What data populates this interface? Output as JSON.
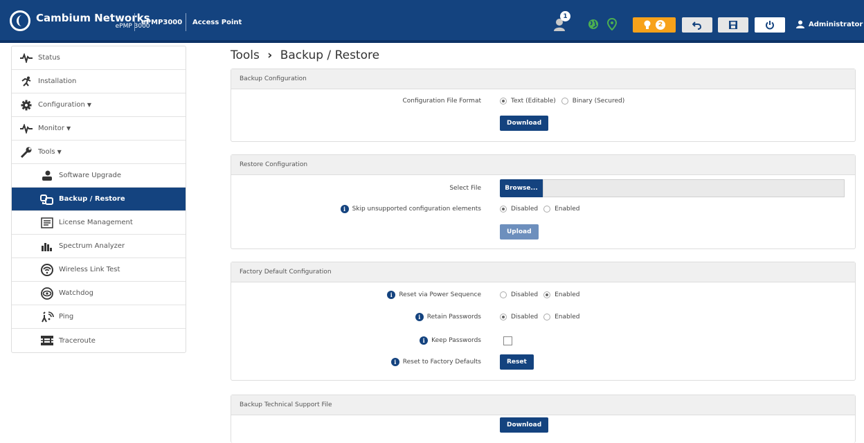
{
  "header": {
    "brand": "Cambium Networks",
    "model": "ePMP 3000",
    "device": "ePMP3000",
    "mode": "Access Point",
    "notification_count": "1",
    "alert_count": "2",
    "user": "Administrator",
    "colors": {
      "bar": "#14437f",
      "alert": "#f7a21b",
      "green": "#4caf50"
    },
    "icons": [
      "user-notification-icon",
      "globe-icon",
      "map-pin-icon",
      "lightbulb-icon",
      "undo-icon",
      "save-icon",
      "power-icon",
      "user-icon"
    ]
  },
  "sidebar": {
    "items": [
      {
        "label": "Status",
        "icon": "pulse-icon"
      },
      {
        "label": "Installation",
        "icon": "runner-icon"
      },
      {
        "label": "Configuration",
        "icon": "gear-icon"
      },
      {
        "label": "Monitor",
        "icon": "pulse-icon"
      },
      {
        "label": "Tools",
        "icon": "wrench-icon"
      },
      {
        "label": "Software Upgrade",
        "icon": "upgrade-icon"
      },
      {
        "label": "Backup / Restore",
        "icon": "backup-icon"
      },
      {
        "label": "License Management",
        "icon": "license-icon"
      },
      {
        "label": "Spectrum Analyzer",
        "icon": "bars-icon"
      },
      {
        "label": "Wireless Link Test",
        "icon": "wifi-icon"
      },
      {
        "label": "Watchdog",
        "icon": "eye-icon"
      },
      {
        "label": "Ping",
        "icon": "ping-icon"
      },
      {
        "label": "Traceroute",
        "icon": "traceroute-icon"
      }
    ]
  },
  "page": {
    "section": "Tools",
    "title": "Backup / Restore"
  },
  "backup": {
    "heading": "Backup Configuration",
    "format_label": "Configuration File Format",
    "format_options": [
      "Text (Editable)",
      "Binary (Secured)"
    ],
    "format_selected": "Text (Editable)",
    "download_label": "Download"
  },
  "restore": {
    "heading": "Restore Configuration",
    "select_file_label": "Select File",
    "browse_label": "Browse...",
    "skip_label": "Skip unsupported configuration elements",
    "skip_options": [
      "Disabled",
      "Enabled"
    ],
    "skip_selected": "Disabled",
    "upload_label": "Upload"
  },
  "factory": {
    "heading": "Factory Default Configuration",
    "reset_power_label": "Reset via Power Sequence",
    "reset_power_options": [
      "Disabled",
      "Enabled"
    ],
    "reset_power_selected": "Enabled",
    "retain_label": "Retain Passwords",
    "retain_options": [
      "Disabled",
      "Enabled"
    ],
    "retain_selected": "Disabled",
    "keep_label": "Keep Passwords",
    "reset_defaults_label": "Reset to Factory Defaults",
    "reset_button": "Reset"
  },
  "support": {
    "heading": "Backup Technical Support File",
    "download_label": "Download"
  }
}
